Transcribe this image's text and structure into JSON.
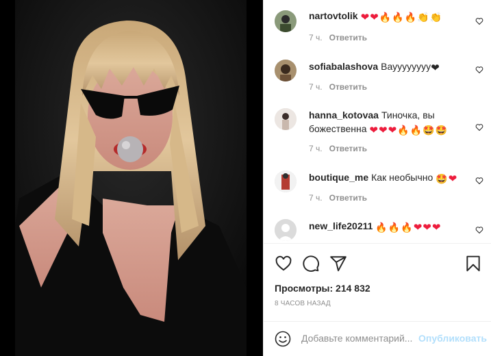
{
  "comments": [
    {
      "user": "nartovtolik",
      "text": "",
      "emoji": [
        "heart",
        "heart",
        "fire",
        "fire",
        "fire",
        "clap",
        "clap"
      ],
      "time": "7 ч.",
      "reply": "Ответить"
    },
    {
      "user": "sofiabalashova",
      "text": "Вауууууууу",
      "emoji": [
        "black-heart"
      ],
      "time": "7 ч.",
      "reply": "Ответить"
    },
    {
      "user": "hanna_kotovaa",
      "text": "Тиночка, вы божественна",
      "emoji": [
        "heart",
        "heart",
        "heart",
        "fire",
        "fire",
        "star-struck",
        "star-struck"
      ],
      "time": "7 ч.",
      "reply": "Ответить"
    },
    {
      "user": "boutique_me",
      "text": "Как необычно",
      "emoji": [
        "star-struck",
        "heart"
      ],
      "time": "7 ч.",
      "reply": "Ответить"
    },
    {
      "user": "new_life20211",
      "text": "",
      "emoji": [
        "fire",
        "fire",
        "fire",
        "heart",
        "heart",
        "heart"
      ],
      "time": "",
      "reply": ""
    }
  ],
  "stats": {
    "views": "Просмотры: 214 832",
    "posted": "8 часов назад"
  },
  "composer": {
    "placeholder": "Добавьте комментарий...",
    "publish": "Опубликовать"
  },
  "icons": {
    "like": "heart-outline-icon",
    "comment": "comment-bubble-icon",
    "share": "paper-plane-icon",
    "save": "bookmark-icon",
    "emoji": "smiley-icon",
    "comment_like": "small-heart-icon"
  },
  "colors": {
    "heart": "#ed1c3c",
    "link_disabled": "#b2dffc",
    "muted": "#8e8e8e",
    "text": "#262626"
  }
}
